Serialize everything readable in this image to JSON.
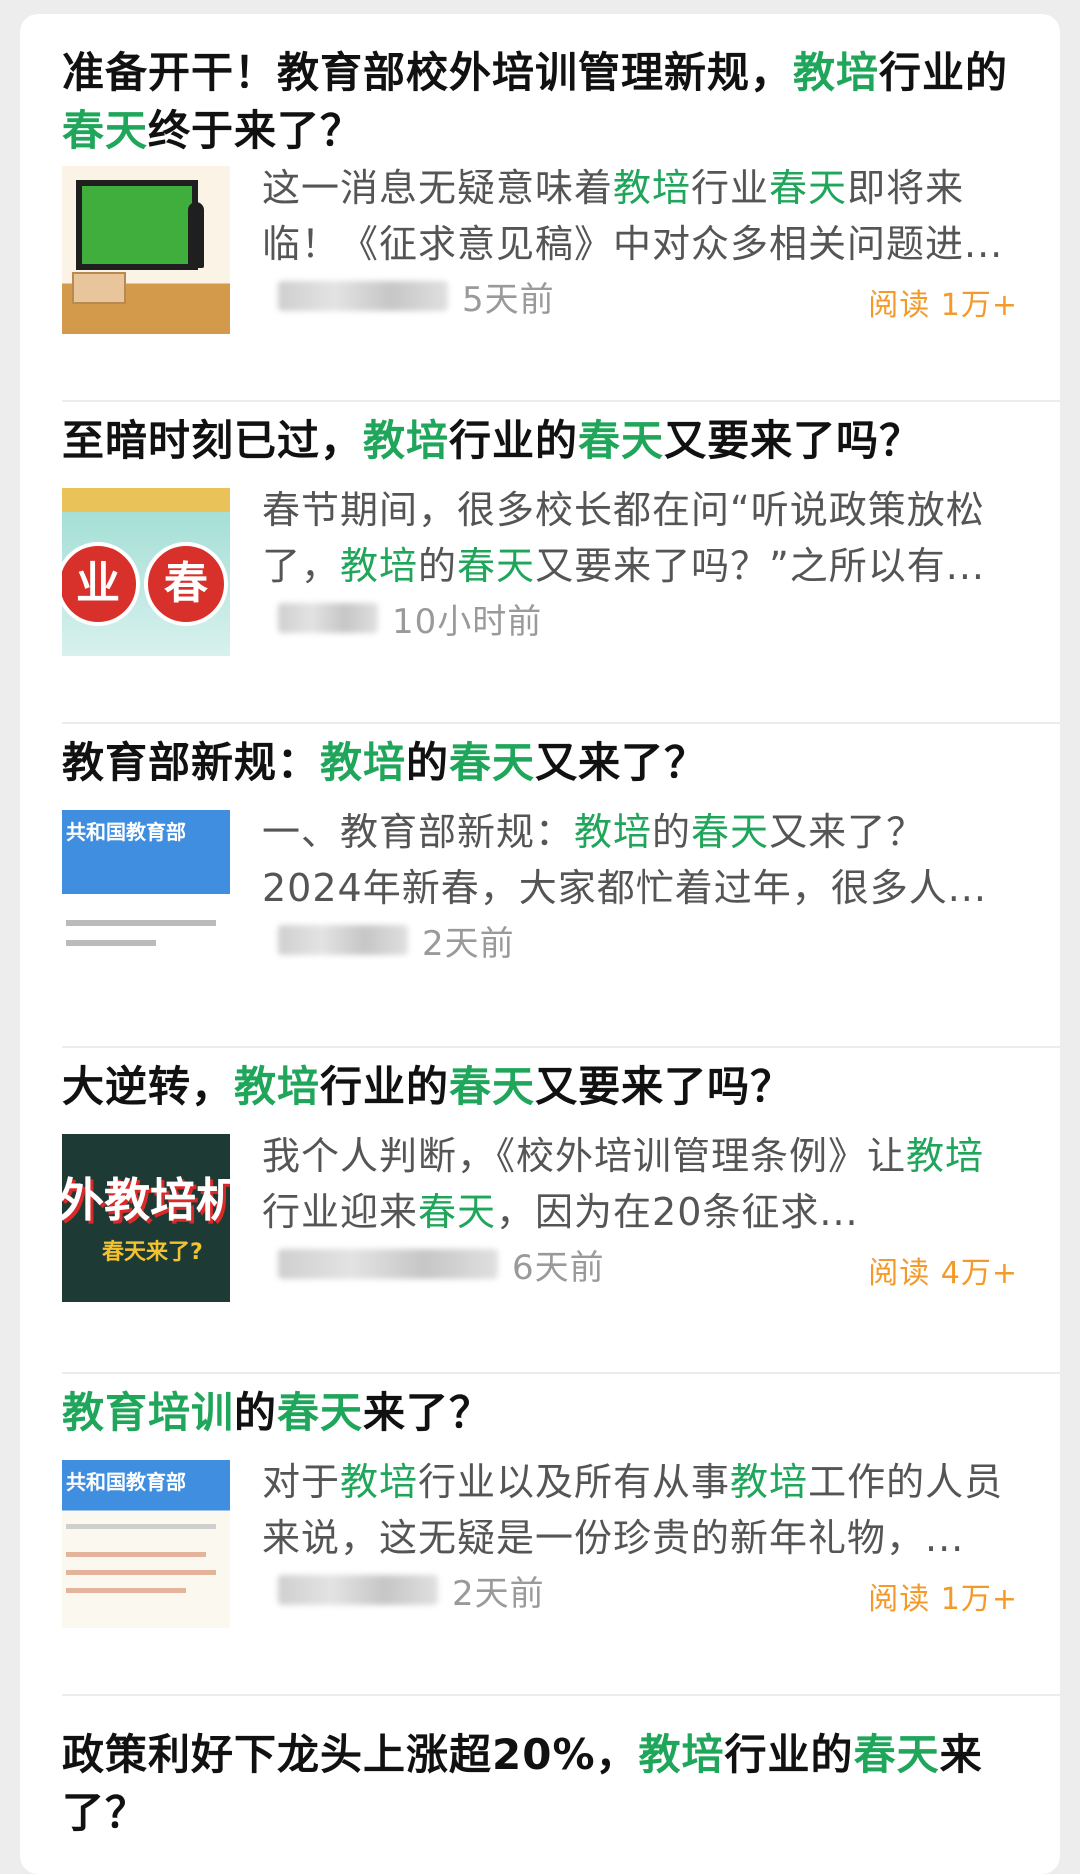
{
  "feed": [
    {
      "title_parts": [
        "准备开干！教育部校外培训管理新规，",
        "教培",
        "行业",
        "的",
        "春天",
        "终于来了？"
      ],
      "excerpt_parts": [
        "这一消息无疑意味着",
        "教培",
        "行业",
        "春天",
        "即将来临！《征求意见稿》中对众多相关问题进..."
      ],
      "time": "5天前",
      "reads": "阅读 1万+"
    },
    {
      "title_parts": [
        "至暗时刻已过，",
        "教培",
        "行业的",
        "春天",
        "又要来了吗？"
      ],
      "excerpt_parts": [
        "春节期间，很多校长都在问“听说政策放松了，",
        "教培",
        "的",
        "春天",
        "又要来了吗？”之所以有..."
      ],
      "thumb_text": [
        "业",
        "春"
      ],
      "time": "10小时前"
    },
    {
      "title_parts": [
        "教育部新规：",
        "教培",
        "的",
        "春天",
        "又来了？"
      ],
      "excerpt_parts": [
        "一、教育部新规：",
        "教培",
        "的",
        "春天",
        "又来了？2024年新春，大家都忙着过年，很多人..."
      ],
      "thumb_text": "共和国教育部",
      "time": "2天前"
    },
    {
      "title_parts": [
        "大逆转，",
        "教培",
        "行业的",
        "春天",
        "又要来了吗？"
      ],
      "excerpt_parts": [
        "我个人判断，《校外培训管理条例》",
        "让",
        "教培",
        "行业迎来",
        "春天",
        "，因为在20条征求..."
      ],
      "thumb_text": [
        "外教培机",
        "春天来了?"
      ],
      "time": "6天前",
      "reads": "阅读 4万+"
    },
    {
      "title_parts": [
        "教育培训",
        "的",
        "春天",
        "来了？"
      ],
      "excerpt_parts": [
        "对于",
        "教培",
        "行业以及所有从事",
        "教培",
        "工作的人员来说，这无疑是一份珍贵的新年礼物，..."
      ],
      "thumb_text": "共和国教育部",
      "time": "2天前",
      "reads": "阅读 1万+"
    },
    {
      "title_parts": [
        "政策利好下龙头上涨超20%，",
        "教培",
        "行业的",
        "春天",
        "来了？"
      ]
    }
  ],
  "colors": {
    "highlight": "#1fa65a",
    "reads": "#f39a2a",
    "meta": "#9a9a9a"
  }
}
